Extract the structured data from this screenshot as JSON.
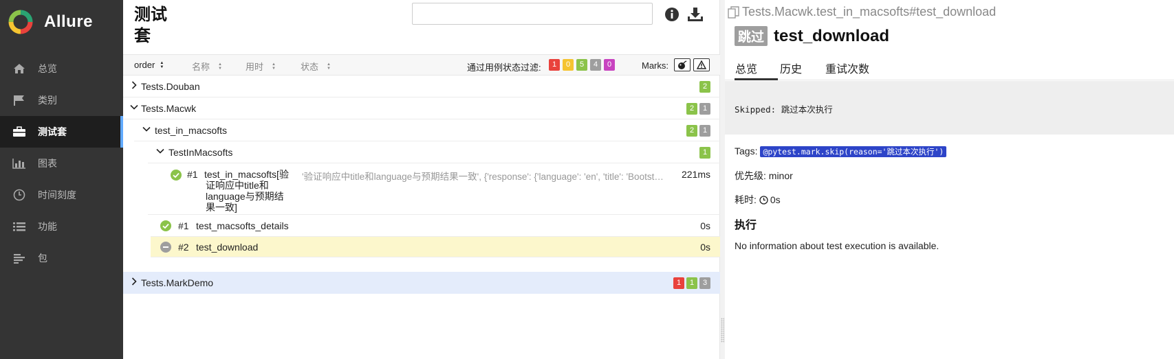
{
  "brand": {
    "name": "Allure"
  },
  "sidebar": {
    "items": [
      {
        "label": "总览",
        "icon": "home-icon"
      },
      {
        "label": "类别",
        "icon": "flag-icon"
      },
      {
        "label": "测试套",
        "icon": "briefcase-icon",
        "active": true
      },
      {
        "label": "图表",
        "icon": "bar-chart-icon"
      },
      {
        "label": "时间刻度",
        "icon": "clock-icon"
      },
      {
        "label": "功能",
        "icon": "list-icon"
      },
      {
        "label": "包",
        "icon": "package-icon"
      }
    ]
  },
  "suites": {
    "title": "测试套",
    "search_placeholder": "",
    "sort": {
      "order": "order",
      "name": "名称",
      "duration": "用时",
      "status": "状态"
    },
    "filter_label": "通过用例状态过滤:",
    "filter_badges": [
      "1",
      "0",
      "5",
      "4",
      "0"
    ],
    "marks_label": "Marks:",
    "tree": {
      "douban": {
        "label": "Tests.Douban",
        "counts": [
          "2"
        ]
      },
      "macwk": {
        "label": "Tests.Macwk",
        "counts": [
          "2",
          "1"
        ]
      },
      "macsofts": {
        "label": "test_in_macsofts",
        "counts": [
          "2",
          "1"
        ]
      },
      "class": {
        "label": "TestInMacsofts",
        "counts": [
          "1"
        ]
      },
      "case1": {
        "num": "#1",
        "name_lines": [
          "test_in_macsofts[验",
          "证响应中title和",
          "language与预期结",
          "果一致]"
        ],
        "params": "'验证响应中title和language与预期结果一致', {'response': {'language': 'en', 'title': 'Bootst…",
        "duration": "221ms"
      },
      "case2": {
        "num": "#1",
        "name": "test_macsofts_details",
        "duration": "0s"
      },
      "case3": {
        "num": "#2",
        "name": "test_download",
        "duration": "0s"
      },
      "markdemo": {
        "label": "Tests.MarkDemo",
        "counts": [
          "1",
          "1",
          "3"
        ]
      }
    }
  },
  "detail": {
    "breadcrumb": "Tests.Macwk.test_in_macsofts#test_download",
    "status_badge": "跳过",
    "title": "test_download",
    "tabs": [
      "总览",
      "历史",
      "重试次数"
    ],
    "message": "Skipped: 跳过本次执行",
    "tags_label": "Tags:",
    "tag": "@pytest.mark.skip(reason='跳过本次执行')",
    "priority": "优先级: minor",
    "duration_label": "耗时:",
    "duration_value": "0s",
    "execution_heading": "执行",
    "execution_text": "No information about test execution is available."
  },
  "colors": {
    "sidebar_bg": "#343434",
    "accent": "#60a9ff",
    "passed": "#8bc34a",
    "failed": "#e9423c",
    "broken": "#f5c431",
    "skipped": "#9e9e9e",
    "unknown": "#c844c0",
    "tag_bg": "#2d44c8",
    "selected_row": "#fcf7cc",
    "hover_row": "#e4ecfb"
  }
}
